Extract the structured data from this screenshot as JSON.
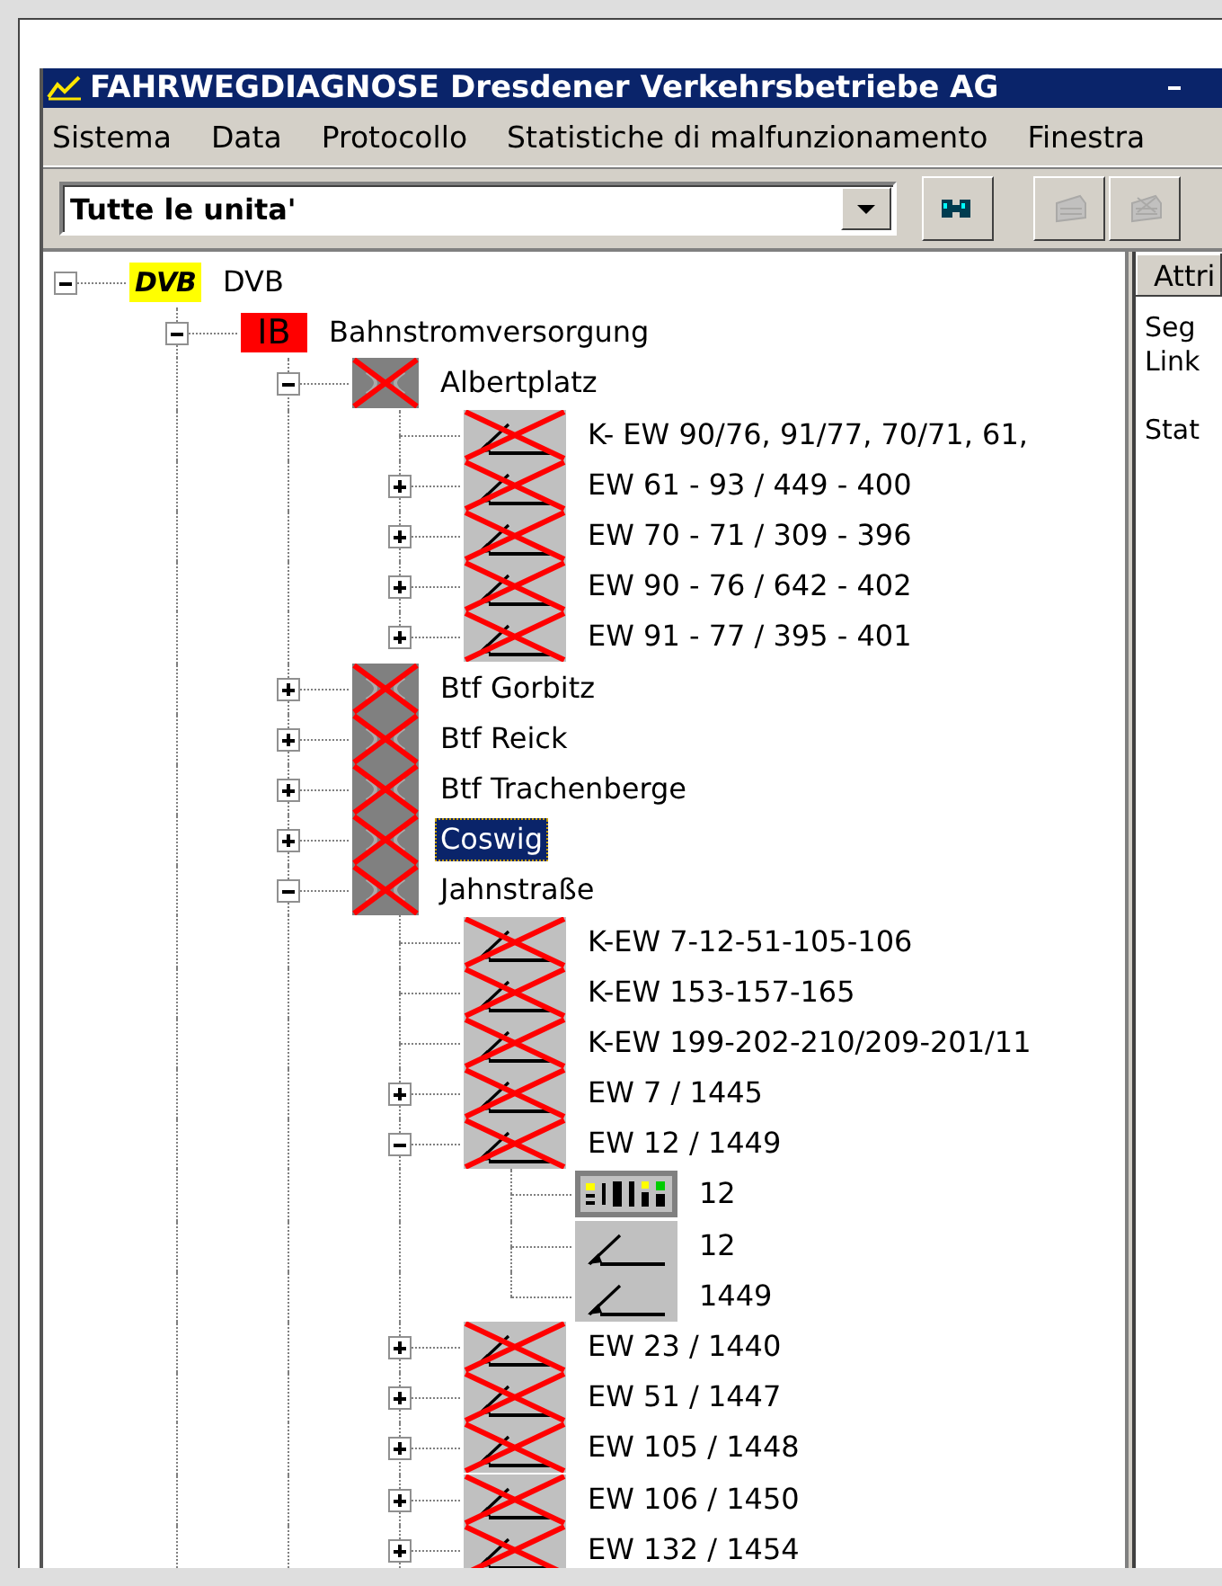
{
  "window": {
    "title": "FAHRWEGDIAGNOSE Dresdener Verkehrsbetriebe AG"
  },
  "menu": [
    "Sistema",
    "Data",
    "Protocollo",
    "Statistiche di malfunzionamento",
    "Finestra"
  ],
  "toolbar": {
    "filter": {
      "value": "Tutte le unita'"
    },
    "buttons": [
      {
        "kind": "find",
        "disabled": false
      },
      {
        "kind": "print",
        "disabled": true
      },
      {
        "kind": "print-all",
        "disabled": true
      }
    ]
  },
  "tree": [
    {
      "label": "DVB",
      "kind": "logo",
      "badge": "DVB",
      "fault": false,
      "expandable": true,
      "expanded": true,
      "selected": false,
      "children": [
        {
          "label": "Bahnstromversorgung",
          "kind": "tag",
          "badge": "IB",
          "fault": false,
          "expandable": true,
          "expanded": true,
          "selected": false,
          "children": [
            {
              "label": "Albertplatz",
              "kind": "station",
              "fault": true,
              "expandable": true,
              "expanded": true,
              "selected": false,
              "children": [
                {
                  "label": "K- EW 90/76, 91/77, 70/71, 61,",
                  "kind": "switch",
                  "fault": true,
                  "expandable": false,
                  "selected": false
                },
                {
                  "label": "EW 61 - 93 / 449 - 400",
                  "kind": "switch",
                  "fault": true,
                  "expandable": true,
                  "expanded": false,
                  "selected": false
                },
                {
                  "label": "EW 70 - 71 / 309 - 396",
                  "kind": "switch",
                  "fault": true,
                  "expandable": true,
                  "expanded": false,
                  "selected": false
                },
                {
                  "label": "EW 90 - 76 / 642 - 402",
                  "kind": "switch",
                  "fault": true,
                  "expandable": true,
                  "expanded": false,
                  "selected": false
                },
                {
                  "label": "EW 91 - 77 / 395 - 401",
                  "kind": "switch",
                  "fault": true,
                  "expandable": true,
                  "expanded": false,
                  "selected": false
                }
              ]
            },
            {
              "label": "Btf Gorbitz",
              "kind": "station",
              "fault": true,
              "expandable": true,
              "expanded": false,
              "selected": false
            },
            {
              "label": "Btf Reick",
              "kind": "station",
              "fault": true,
              "expandable": true,
              "expanded": false,
              "selected": false
            },
            {
              "label": "Btf Trachenberge",
              "kind": "station",
              "fault": true,
              "expandable": true,
              "expanded": false,
              "selected": false
            },
            {
              "label": "Coswig",
              "kind": "station",
              "fault": true,
              "expandable": true,
              "expanded": false,
              "selected": true
            },
            {
              "label": "Jahnstraße",
              "kind": "station",
              "fault": true,
              "expandable": true,
              "expanded": true,
              "selected": false,
              "children": [
                {
                  "label": "K-EW 7-12-51-105-106",
                  "kind": "switch",
                  "fault": true,
                  "expandable": false,
                  "selected": false
                },
                {
                  "label": "K-EW 153-157-165",
                  "kind": "switch",
                  "fault": true,
                  "expandable": false,
                  "selected": false
                },
                {
                  "label": "K-EW 199-202-210/209-201/11",
                  "kind": "switch",
                  "fault": true,
                  "expandable": false,
                  "selected": false
                },
                {
                  "label": "EW 7 / 1445",
                  "kind": "switch",
                  "fault": true,
                  "expandable": true,
                  "expanded": false,
                  "selected": false
                },
                {
                  "label": "EW 12 / 1449",
                  "kind": "switch",
                  "fault": true,
                  "expandable": true,
                  "expanded": true,
                  "selected": false,
                  "children": [
                    {
                      "label": "12",
                      "kind": "lights",
                      "fault": false,
                      "expandable": false,
                      "selected": false
                    },
                    {
                      "label": "12",
                      "kind": "switch",
                      "fault": false,
                      "expandable": false,
                      "selected": false
                    },
                    {
                      "label": "1449",
                      "kind": "switch",
                      "fault": false,
                      "expandable": false,
                      "selected": false
                    }
                  ]
                },
                {
                  "label": "EW 23 / 1440",
                  "kind": "switch",
                  "fault": true,
                  "expandable": true,
                  "expanded": false,
                  "selected": false
                },
                {
                  "label": "EW 51 / 1447",
                  "kind": "switch",
                  "fault": true,
                  "expandable": true,
                  "expanded": false,
                  "selected": false
                },
                {
                  "label": "EW 105 / 1448",
                  "kind": "switch",
                  "fault": true,
                  "expandable": true,
                  "expanded": false,
                  "selected": false
                },
                {
                  "label": "EW 106 / 1450",
                  "kind": "switch",
                  "fault": true,
                  "expandable": true,
                  "expanded": false,
                  "selected": false
                },
                {
                  "label": "EW 132 / 1454",
                  "kind": "switch",
                  "fault": true,
                  "expandable": true,
                  "expanded": false,
                  "selected": false
                }
              ]
            }
          ]
        }
      ]
    }
  ],
  "attributes": {
    "header": "Attri",
    "lines": [
      "Seg",
      "Link",
      "Stat"
    ]
  }
}
